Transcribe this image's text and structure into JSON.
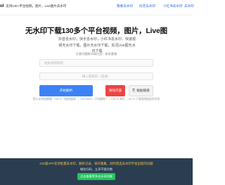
{
  "header": {
    "brand_logo": "ol",
    "brand_tagline": "支持130+平台视频，图片，Live图片去水印",
    "nav": [
      "我要去水印",
      "抖音去水印",
      "小红书去水印",
      "去水印"
    ],
    "menu_icon": "chevron-down-icon"
  },
  "main": {
    "title": "无水印下载130多个平台视频，图片，Live图",
    "subtitle": "抖音去水印，快手去水印，小红书去水印，快速视频无水印下载，图片无水印下载，实况Live图无水印下载",
    "hint": "注意问题解决请扫这：联系客服",
    "input1_placeholder": "粘贴视频链接",
    "input2_placeholder": "输入提取码（选填）"
  },
  "actions": {
    "parse_label": "开始解析",
    "clear_label": "清除内容",
    "paste_label": "粘贴链接",
    "paste_icon": "clipboard-icon",
    "shortcut_tip": "提示支持快捷键：Ctrl+V（粘贴链接），Ctrl+Enter（开始解析），Ctrl+X 清空，Ctrl+A 下载视频链接到本地"
  },
  "footer": {
    "notice": "iOS版APP支持批量去水印，解析记录，保存图集，同时借出去水印不会出现的问题",
    "sub": "微信扫码，立享不限次数",
    "button_label": "点击查看更多去水印功能"
  },
  "colors": {
    "primary": "#3b82f6",
    "danger": "#ef4444",
    "success": "#22c55e",
    "footer_bg": "#2b3e51",
    "notice": "#f6c343",
    "link": "#2563eb"
  }
}
